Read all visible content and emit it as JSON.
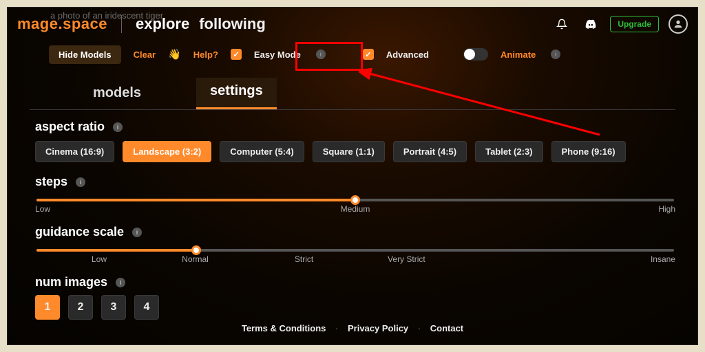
{
  "brand": "mage.space",
  "prompt_ghost": "a photo of an iridescent tiger",
  "nav": {
    "explore": "explore",
    "following": "following"
  },
  "header_actions": {
    "upgrade": "Upgrade"
  },
  "options": {
    "hide_models": "Hide Models",
    "clear": "Clear",
    "help": "Help?",
    "easy_mode": "Easy Mode",
    "advanced": "Advanced",
    "animate": "Animate"
  },
  "tabs": {
    "models": "models",
    "settings": "settings"
  },
  "aspect_ratio": {
    "title": "aspect ratio",
    "items": [
      "Cinema (16:9)",
      "Landscape (3:2)",
      "Computer (5:4)",
      "Square (1:1)",
      "Portrait (4:5)",
      "Tablet (2:3)",
      "Phone (9:16)"
    ],
    "selected_index": 1
  },
  "steps": {
    "title": "steps",
    "labels": {
      "low": "Low",
      "medium": "Medium",
      "high": "High"
    },
    "percent": 50
  },
  "guidance": {
    "title": "guidance scale",
    "labels": {
      "low": "Low",
      "normal": "Normal",
      "strict": "Strict",
      "very_strict": "Very Strict",
      "insane": "Insane"
    },
    "percent": 25
  },
  "num_images": {
    "title": "num images",
    "values": [
      "1",
      "2",
      "3",
      "4"
    ],
    "selected_index": 0
  },
  "footer": {
    "terms": "Terms & Conditions",
    "privacy": "Privacy Policy",
    "contact": "Contact"
  },
  "chart_data": {
    "type": "table",
    "title": "Settings panel values",
    "rows": [
      {
        "setting": "aspect ratio",
        "value": "Landscape (3:2)"
      },
      {
        "setting": "steps",
        "value": "Medium (≈50%)"
      },
      {
        "setting": "guidance scale",
        "value": "Normal (≈25%)"
      },
      {
        "setting": "num images",
        "value": 1
      }
    ]
  }
}
